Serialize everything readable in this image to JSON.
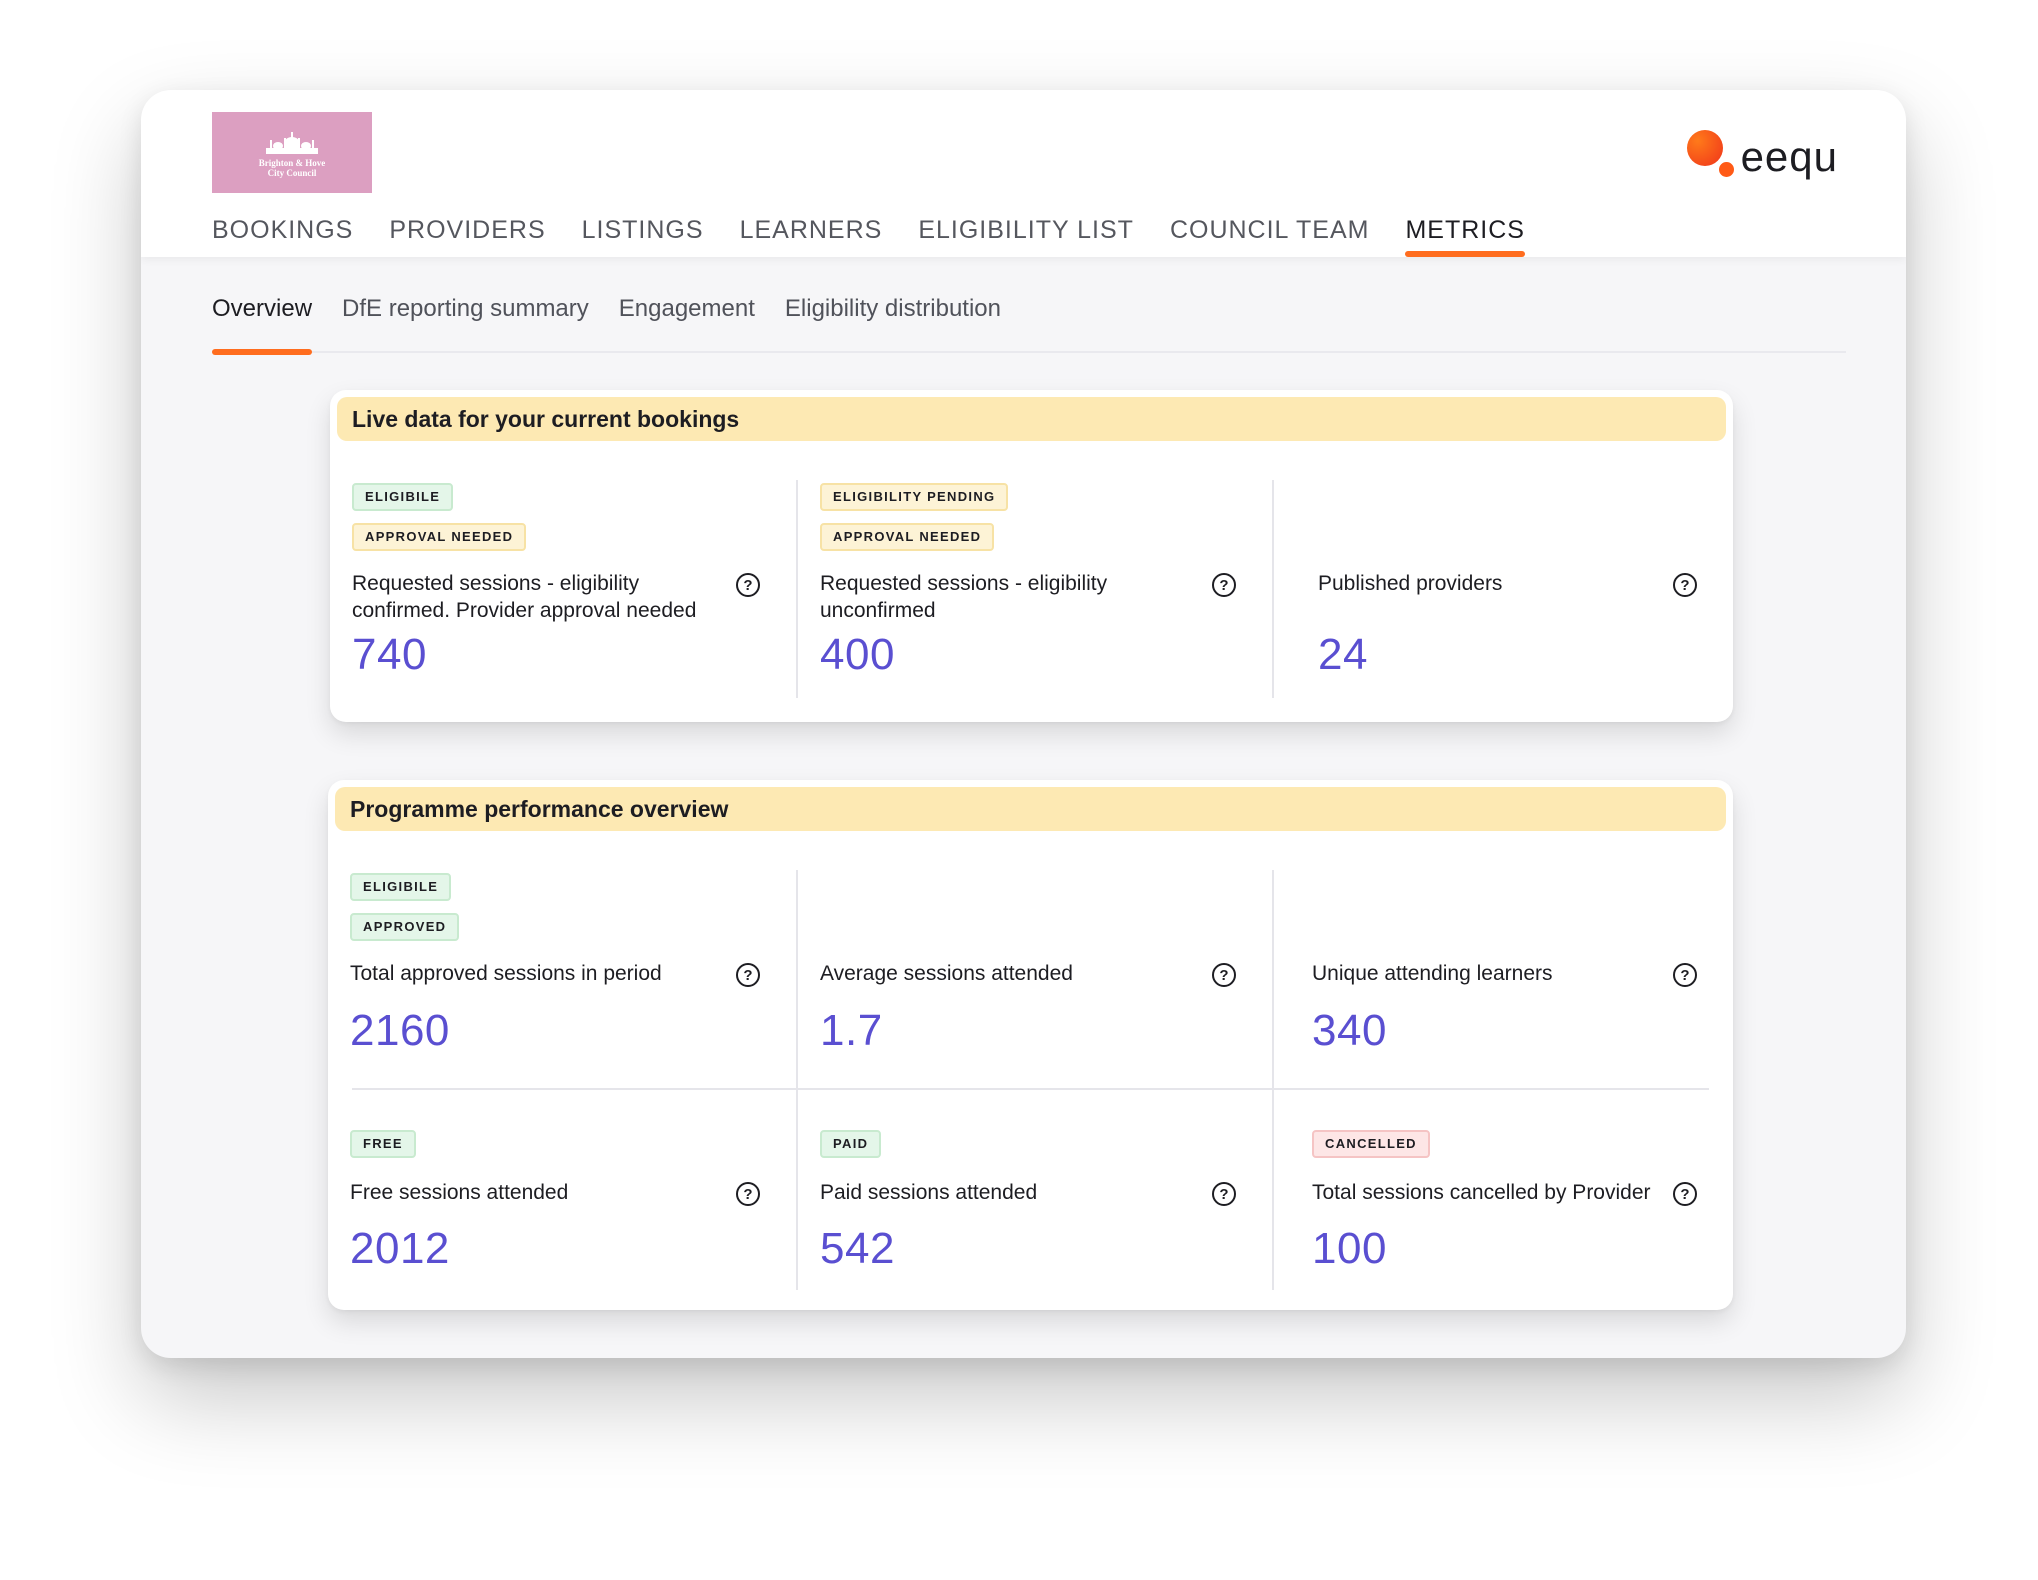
{
  "council_logo": {
    "line1": "Brighton & Hove",
    "line2": "City Council"
  },
  "brand": {
    "name": "eequ"
  },
  "main_nav": [
    "BOOKINGS",
    "PROVIDERS",
    "LISTINGS",
    "LEARNERS",
    "ELIGIBILITY LIST",
    "COUNCIL TEAM",
    "METRICS"
  ],
  "main_nav_active": "METRICS",
  "sub_tabs": [
    "Overview",
    "DfE reporting summary",
    "Engagement",
    "Eligibility distribution"
  ],
  "sub_tab_active": "Overview",
  "live_card": {
    "title": "Live data for your current bookings",
    "metrics": [
      {
        "badges": [
          "ELIGIBILE",
          "APPROVAL NEEDED"
        ],
        "label": "Requested sessions - eligibility confirmed. Provider approval needed",
        "value": "740"
      },
      {
        "badges": [
          "ELIGIBILITY PENDING",
          "APPROVAL NEEDED"
        ],
        "label": "Requested sessions - eligibility unconfirmed",
        "value": "400"
      },
      {
        "badges": [],
        "label": "Published providers",
        "value": "24"
      }
    ]
  },
  "performance_card": {
    "title": "Programme performance overview",
    "metrics": [
      {
        "badges": [
          "ELIGIBILE",
          "APPROVED"
        ],
        "label": "Total approved sessions in period",
        "value": "2160"
      },
      {
        "badges": [],
        "label": "Average sessions attended",
        "value": "1.7"
      },
      {
        "badges": [],
        "label": "Unique attending learners",
        "value": "340"
      },
      {
        "badges": [
          "FREE"
        ],
        "label": "Free sessions attended",
        "value": "2012"
      },
      {
        "badges": [
          "PAID"
        ],
        "label": "Paid sessions attended",
        "value": "542"
      },
      {
        "badges": [
          "CANCELLED"
        ],
        "label": "Total sessions cancelled by Provider",
        "value": "100"
      }
    ]
  },
  "help_icon_glyph": "?",
  "colors": {
    "accent": "#ff6d1f",
    "value": "#5a4fd1",
    "card_header": "#fde9b3",
    "council_logo_bg": "#dc9fc1"
  }
}
